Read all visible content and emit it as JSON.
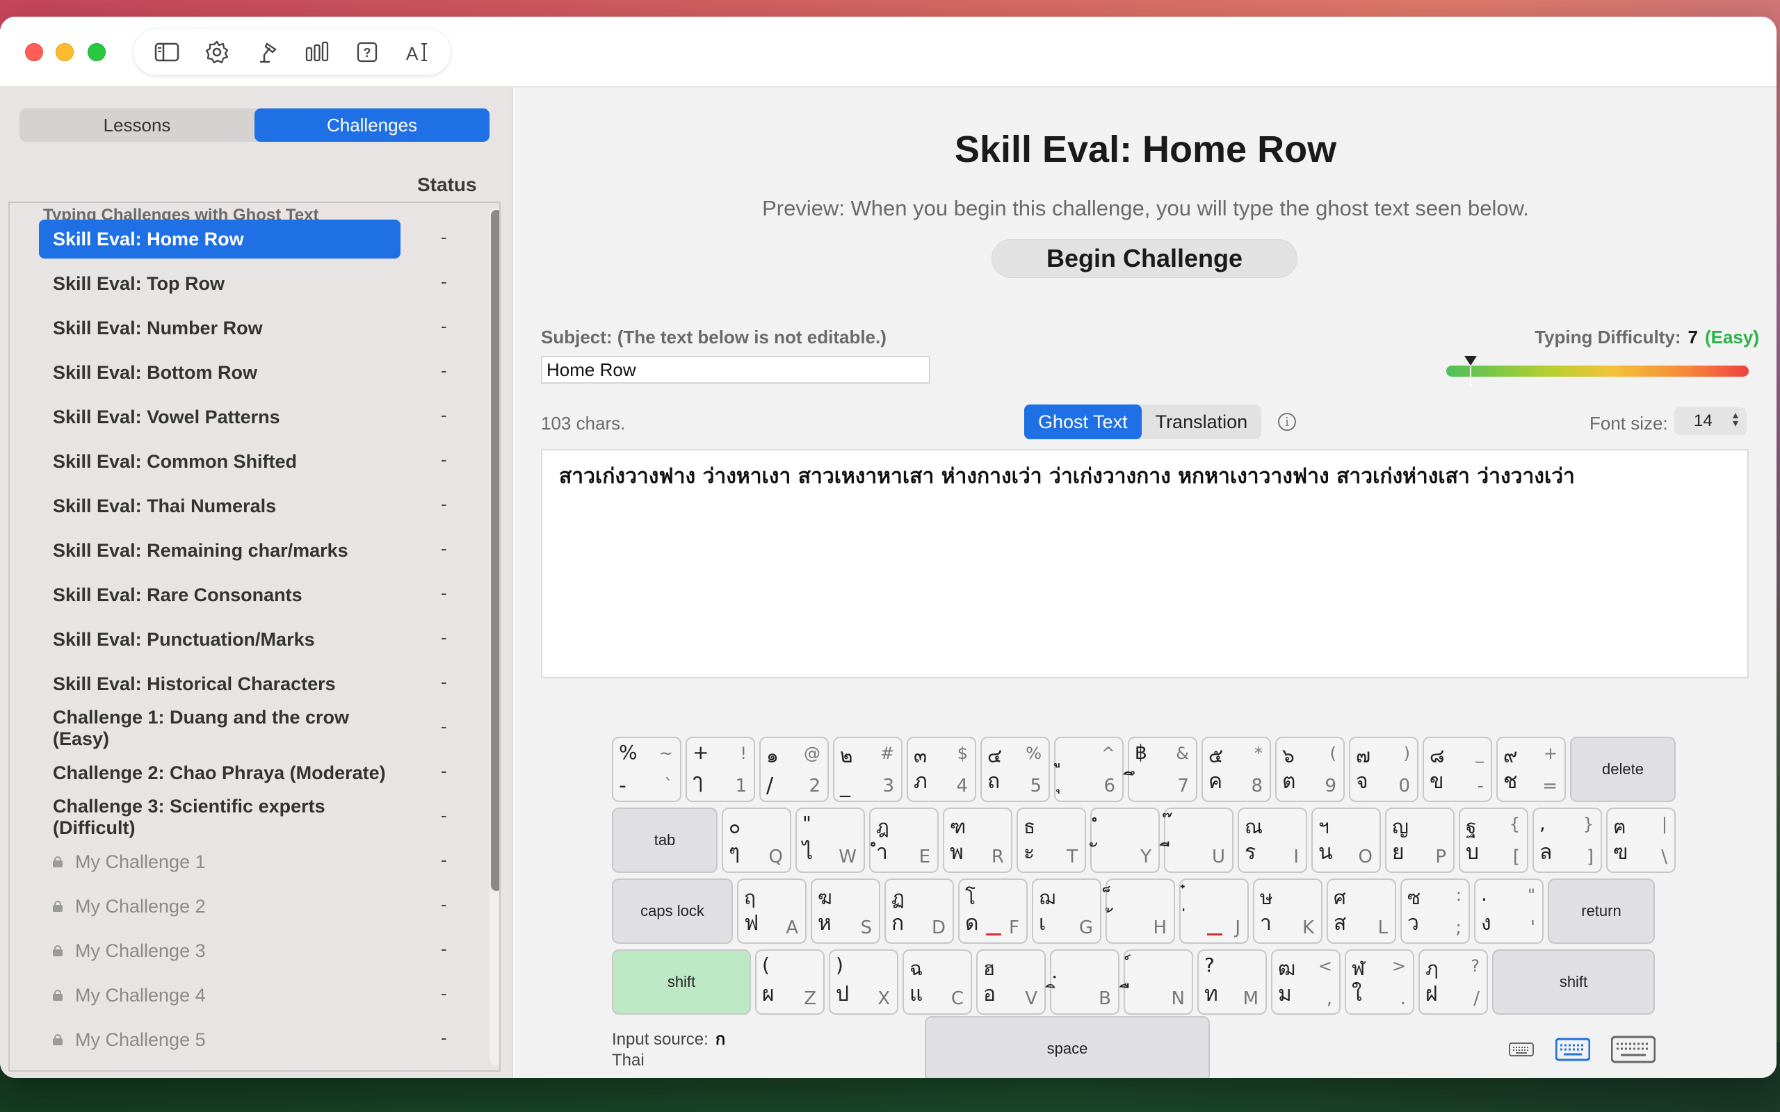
{
  "toolbar": {
    "icons": [
      "sidebar-icon",
      "gear-icon",
      "desk-lamp-icon",
      "bar-chart-icon",
      "help-icon",
      "text-size-icon"
    ]
  },
  "sidebar": {
    "tabs": [
      {
        "label": "Lessons",
        "active": false
      },
      {
        "label": "Challenges",
        "active": true
      }
    ],
    "status_header": "Status",
    "group_title": "Typing Challenges with Ghost Text",
    "items": [
      {
        "label": "Skill Eval: Home Row",
        "status": "-",
        "selected": true,
        "locked": false
      },
      {
        "label": "Skill Eval: Top Row",
        "status": "-",
        "selected": false,
        "locked": false
      },
      {
        "label": "Skill Eval: Number Row",
        "status": "-",
        "selected": false,
        "locked": false
      },
      {
        "label": "Skill Eval: Bottom Row",
        "status": "-",
        "selected": false,
        "locked": false
      },
      {
        "label": "Skill Eval: Vowel Patterns",
        "status": "-",
        "selected": false,
        "locked": false
      },
      {
        "label": "Skill Eval: Common Shifted",
        "status": "-",
        "selected": false,
        "locked": false
      },
      {
        "label": "Skill Eval: Thai Numerals",
        "status": "-",
        "selected": false,
        "locked": false
      },
      {
        "label": "Skill Eval: Remaining char/marks",
        "status": "-",
        "selected": false,
        "locked": false
      },
      {
        "label": "Skill Eval: Rare Consonants",
        "status": "-",
        "selected": false,
        "locked": false
      },
      {
        "label": "Skill Eval: Punctuation/Marks",
        "status": "-",
        "selected": false,
        "locked": false
      },
      {
        "label": "Skill Eval: Historical Characters",
        "status": "-",
        "selected": false,
        "locked": false
      },
      {
        "label": "Challenge 1: Duang and the crow (Easy)",
        "status": "-",
        "selected": false,
        "locked": false
      },
      {
        "label": "Challenge 2: Chao Phraya (Moderate)",
        "status": "-",
        "selected": false,
        "locked": false
      },
      {
        "label": "Challenge 3: Scientific experts (Difficult)",
        "status": "-",
        "selected": false,
        "locked": false
      },
      {
        "label": "My Challenge 1",
        "status": "-",
        "selected": false,
        "locked": true
      },
      {
        "label": "My Challenge 2",
        "status": "-",
        "selected": false,
        "locked": true
      },
      {
        "label": "My Challenge 3",
        "status": "-",
        "selected": false,
        "locked": true
      },
      {
        "label": "My Challenge 4",
        "status": "-",
        "selected": false,
        "locked": true
      },
      {
        "label": "My Challenge 5",
        "status": "-",
        "selected": false,
        "locked": true
      }
    ]
  },
  "main": {
    "title": "Skill Eval: Home Row",
    "preview": "Preview: When you begin this challenge, you will type the ghost text seen below.",
    "begin_button": "Begin Challenge",
    "subject_label": "Subject:  (The text below is not editable.)",
    "subject_value": "Home Row",
    "difficulty_label": "Typing Difficulty:",
    "difficulty_value": "7",
    "difficulty_word": "(Easy)",
    "difficulty_fraction": 0.08,
    "char_count": "103 chars.",
    "view_tabs": [
      {
        "label": "Ghost Text",
        "active": true
      },
      {
        "label": "Translation",
        "active": false
      }
    ],
    "font_size_label": "Font size:",
    "font_size_value": "14",
    "ghost_text": "สาวเก่งวางฟาง ว่างหาเงา สาวเหงาหาเสา ห่างกางเว่า ว่าเก่งวางกาง หกหาเงาวางฟาง สาวเก่งห่างเสา ว่างวางเว่า"
  },
  "keyboard": {
    "rows": [
      [
        {
          "tl": "%",
          "tr": "~",
          "bl": "-",
          "br": "`"
        },
        {
          "tl": "+",
          "tr": "!",
          "bl": "ๅ",
          "br": "1"
        },
        {
          "tl": "๑",
          "tr": "@",
          "bl": "/",
          "br": "2"
        },
        {
          "tl": "๒",
          "tr": "#",
          "bl": "_",
          "br": "3"
        },
        {
          "tl": "๓",
          "tr": "$",
          "bl": "ภ",
          "br": "4"
        },
        {
          "tl": "๔",
          "tr": "%",
          "bl": "ถ",
          "br": "5"
        },
        {
          "tl": "ู",
          "tr": "^",
          "bl": "ุ",
          "br": "6"
        },
        {
          "tl": "฿",
          "tr": "&",
          "bl": "ึ",
          "br": "7"
        },
        {
          "tl": "๕",
          "tr": "*",
          "bl": "ค",
          "br": "8"
        },
        {
          "tl": "๖",
          "tr": "(",
          "bl": "ต",
          "br": "9"
        },
        {
          "tl": "๗",
          "tr": ")",
          "bl": "จ",
          "br": "0"
        },
        {
          "tl": "๘",
          "tr": "_",
          "bl": "ข",
          "br": "-"
        },
        {
          "tl": "๙",
          "tr": "+",
          "bl": "ช",
          "br": "="
        }
      ],
      [
        {
          "tl": "๐",
          "tr": "",
          "bl": "ๆ",
          "br": "Q"
        },
        {
          "tl": "\"",
          "tr": "",
          "bl": "ไ",
          "br": "W"
        },
        {
          "tl": "ฎ",
          "tr": "",
          "bl": "ำ",
          "br": "E"
        },
        {
          "tl": "ฑ",
          "tr": "",
          "bl": "พ",
          "br": "R"
        },
        {
          "tl": "ธ",
          "tr": "",
          "bl": "ะ",
          "br": "T"
        },
        {
          "tl": "ํ",
          "tr": "",
          "bl": "ั",
          "br": "Y"
        },
        {
          "tl": "๊",
          "tr": "",
          "bl": "ี",
          "br": "U"
        },
        {
          "tl": "ณ",
          "tr": "",
          "bl": "ร",
          "br": "I"
        },
        {
          "tl": "ฯ",
          "tr": "",
          "bl": "น",
          "br": "O"
        },
        {
          "tl": "ญ",
          "tr": "",
          "bl": "ย",
          "br": "P"
        },
        {
          "tl": "ฐ",
          "tr": "{",
          "bl": "บ",
          "br": "["
        },
        {
          "tl": ",",
          "tr": "}",
          "bl": "ล",
          "br": "]"
        },
        {
          "tl": "ฅ",
          "tr": "|",
          "bl": "ฃ",
          "br": "\\"
        }
      ],
      [
        {
          "tl": "ฤ",
          "tr": "",
          "bl": "ฟ",
          "br": "A",
          "home": false
        },
        {
          "tl": "ฆ",
          "tr": "",
          "bl": "ห",
          "br": "S",
          "home": false
        },
        {
          "tl": "ฏ",
          "tr": "",
          "bl": "ก",
          "br": "D",
          "home": false
        },
        {
          "tl": "โ",
          "tr": "",
          "bl": "ด",
          "br": "F",
          "home": true
        },
        {
          "tl": "ฌ",
          "tr": "",
          "bl": "เ",
          "br": "G",
          "home": false
        },
        {
          "tl": "็",
          "tr": "",
          "bl": "้",
          "br": "H",
          "home": false
        },
        {
          "tl": "๋",
          "tr": "",
          "bl": "่",
          "br": "J",
          "home": true
        },
        {
          "tl": "ษ",
          "tr": "",
          "bl": "า",
          "br": "K",
          "home": false
        },
        {
          "tl": "ศ",
          "tr": "",
          "bl": "ส",
          "br": "L",
          "home": false
        },
        {
          "tl": "ซ",
          "tr": ":",
          "bl": "ว",
          "br": ";",
          "home": false
        },
        {
          "tl": ".",
          "tr": "\"",
          "bl": "ง",
          "br": "'",
          "home": false
        }
      ],
      [
        {
          "tl": "(",
          "tr": "",
          "bl": "ผ",
          "br": "Z"
        },
        {
          "tl": ")",
          "tr": "",
          "bl": "ป",
          "br": "X"
        },
        {
          "tl": "ฉ",
          "tr": "",
          "bl": "แ",
          "br": "C"
        },
        {
          "tl": "ฮ",
          "tr": "",
          "bl": "อ",
          "br": "V"
        },
        {
          "tl": "ฺ",
          "tr": "",
          "bl": "ิ",
          "br": "B"
        },
        {
          "tl": "์",
          "tr": "",
          "bl": "ื",
          "br": "N"
        },
        {
          "tl": "?",
          "tr": "",
          "bl": "ท",
          "br": "M"
        },
        {
          "tl": "ฒ",
          "tr": "<",
          "bl": "ม",
          "br": ","
        },
        {
          "tl": "ฬ",
          "tr": ">",
          "bl": "ใ",
          "br": "."
        },
        {
          "tl": "ฦ",
          "tr": "?",
          "bl": "ฝ",
          "br": "/"
        }
      ]
    ],
    "specials": {
      "delete": "delete",
      "tab": "tab",
      "caps_lock": "caps lock",
      "return": "return",
      "shift_left": "shift",
      "shift_right": "shift",
      "space": "space"
    },
    "input_source_label": "Input source:",
    "input_source_glyph": "ก",
    "input_source_name": "Thai",
    "size_icons": [
      "keyboard-small-icon",
      "keyboard-medium-icon",
      "keyboard-large-icon"
    ],
    "size_selected": "keyboard-medium-icon"
  },
  "colors": {
    "accent": "#1f6fe5",
    "easy": "#2bb24a",
    "shift_active": "#bde8c4"
  }
}
